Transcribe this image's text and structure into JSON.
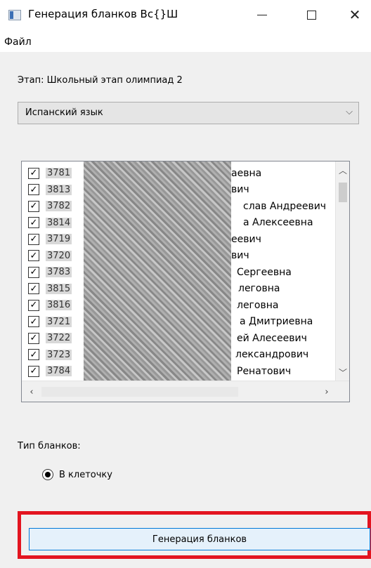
{
  "window": {
    "title": "Генерация бланков Вс{}Ш",
    "minimize_glyph": "—",
    "close_glyph": "✕"
  },
  "menu": {
    "file": "Файл"
  },
  "stage": {
    "label": "Этап: Школьный этап олимпиад 2"
  },
  "subject_select": {
    "value": "Испанский язык"
  },
  "participants": {
    "items": [
      {
        "id": "3781",
        "name": "аевна",
        "checked": true
      },
      {
        "id": "3813",
        "name": "вич",
        "checked": true
      },
      {
        "id": "3782",
        "name": "слав Андреевич",
        "checked": true
      },
      {
        "id": "3814",
        "name": "а Алексеевна",
        "checked": true
      },
      {
        "id": "3719",
        "name": "еевич",
        "checked": true
      },
      {
        "id": "3720",
        "name": "вич",
        "checked": true
      },
      {
        "id": "3783",
        "name": "Сергеевна",
        "checked": true
      },
      {
        "id": "3815",
        "name": "леговна",
        "checked": true
      },
      {
        "id": "3816",
        "name": "леговна",
        "checked": true
      },
      {
        "id": "3721",
        "name": "а Дмитриевна",
        "checked": true
      },
      {
        "id": "3722",
        "name": "ей Алесеевич",
        "checked": true
      },
      {
        "id": "3723",
        "name": "лександрович",
        "checked": true
      },
      {
        "id": "3784",
        "name": "Ренатович",
        "checked": true
      }
    ],
    "checkmark_glyph": "✓"
  },
  "blank_type": {
    "label": "Тип бланков:",
    "option": "В клеточку",
    "selected": true
  },
  "generate_button": {
    "label": "Генерация бланков"
  },
  "colors": {
    "highlight": "#e3141f",
    "button_border": "#0078d7",
    "button_bg": "#e5f1fb"
  }
}
